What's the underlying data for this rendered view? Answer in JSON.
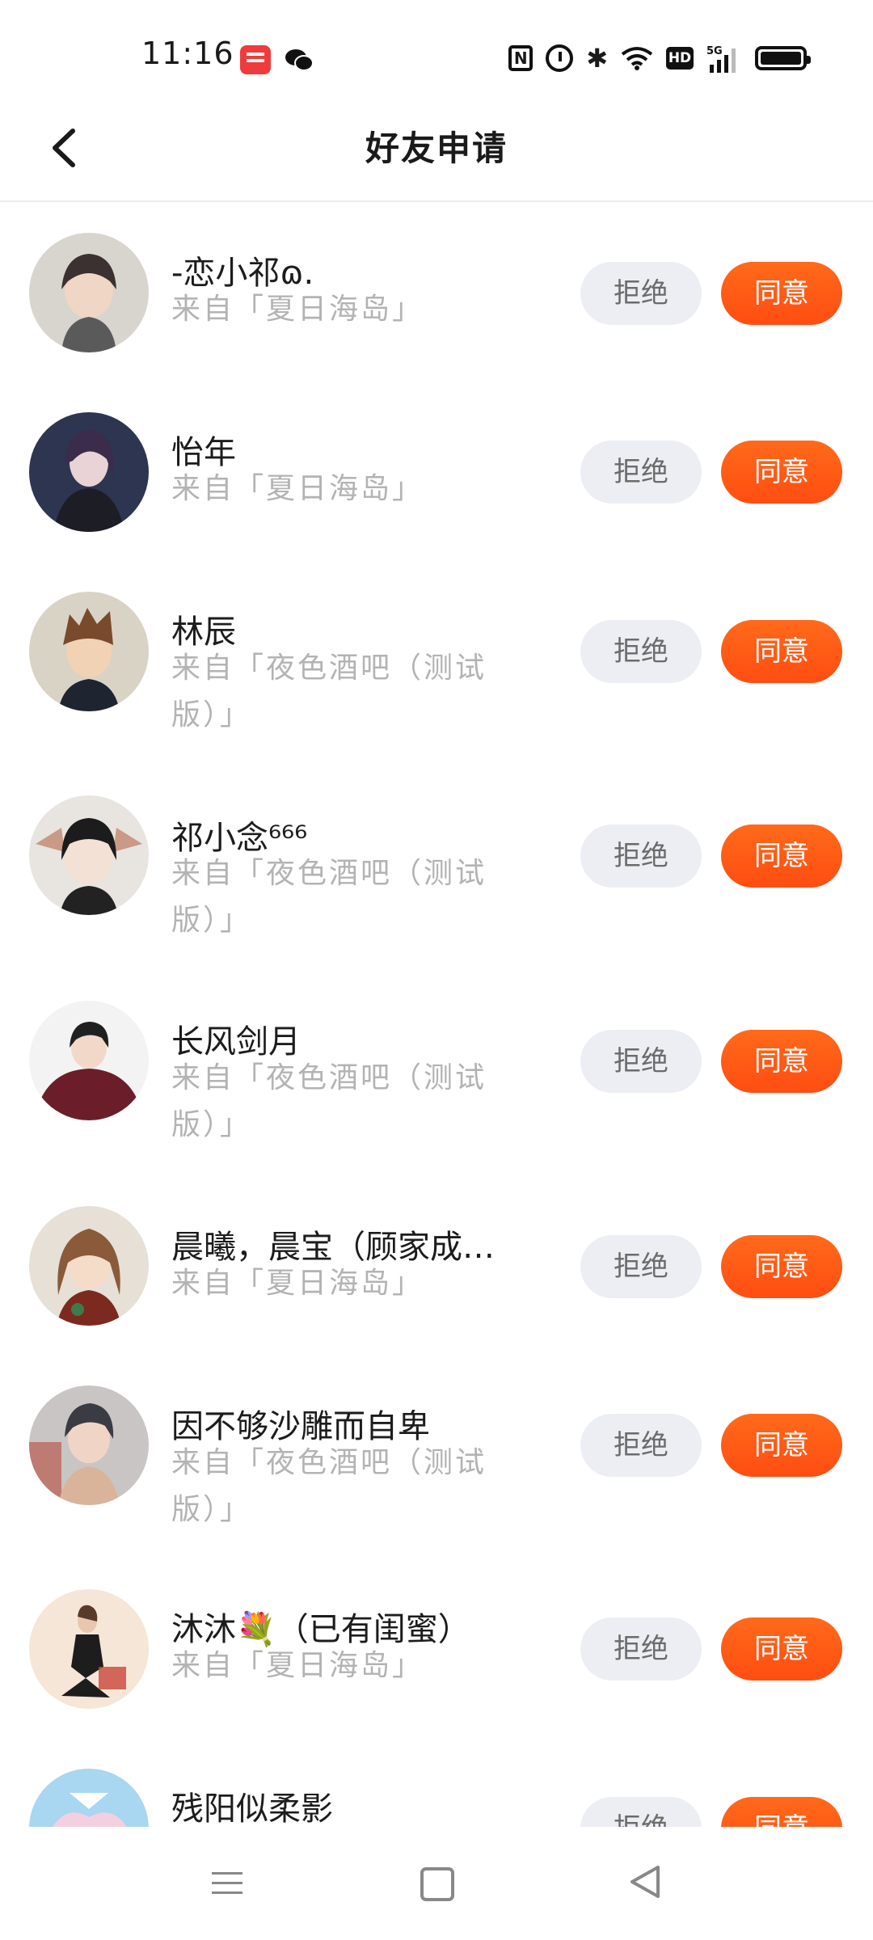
{
  "status_bar": {
    "time": "11:16",
    "icons": [
      "xiaohongshu-app-icon",
      "wechat-icon",
      "nfc-icon",
      "alarm-icon",
      "bluetooth-icon",
      "wifi-icon",
      "hd-icon",
      "signal-5g-icon",
      "battery-icon"
    ],
    "nfc_label": "N",
    "bt_label": "✱",
    "hd_label": "HD"
  },
  "header": {
    "title": "好友申请",
    "back_icon": "chevron-left-icon"
  },
  "requests": [
    {
      "name": "-恋小祁ɷ.",
      "source_line1": "来自「夏日海岛」",
      "source_line2": "",
      "reject": "拒绝",
      "accept": "同意"
    },
    {
      "name": "怡年",
      "source_line1": "来自「夏日海岛」",
      "source_line2": "",
      "reject": "拒绝",
      "accept": "同意"
    },
    {
      "name": "林辰",
      "source_line1": "来自「夜色酒吧（测试",
      "source_line2": "版）」",
      "reject": "拒绝",
      "accept": "同意"
    },
    {
      "name": "祁小念⁶⁶⁶",
      "source_line1": "来自「夜色酒吧（测试",
      "source_line2": "版）」",
      "reject": "拒绝",
      "accept": "同意"
    },
    {
      "name": "长风剑月",
      "source_line1": "来自「夜色酒吧（测试",
      "source_line2": "版）」",
      "reject": "拒绝",
      "accept": "同意"
    },
    {
      "name": "晨曦，晨宝（顾家成…",
      "source_line1": "来自「夏日海岛」",
      "source_line2": "",
      "reject": "拒绝",
      "accept": "同意"
    },
    {
      "name": "因不够沙雕而自卑",
      "source_line1": "来自「夜色酒吧（测试",
      "source_line2": "版）」",
      "reject": "拒绝",
      "accept": "同意"
    },
    {
      "name": "沐沐💐（已有闺蜜）",
      "source_line1": "来自「夏日海岛」",
      "source_line2": "",
      "reject": "拒绝",
      "accept": "同意"
    },
    {
      "name": "残阳似柔影",
      "source_line1": "",
      "source_line2": "",
      "reject": "拒绝",
      "accept": "同意"
    }
  ],
  "nav_bar": {
    "icons": [
      "menu-icon",
      "home-icon",
      "back-triangle-icon"
    ]
  },
  "colors": {
    "accent": "#ff5a14",
    "reject_bg": "#eceef3",
    "source_text": "#b3b3b3"
  }
}
